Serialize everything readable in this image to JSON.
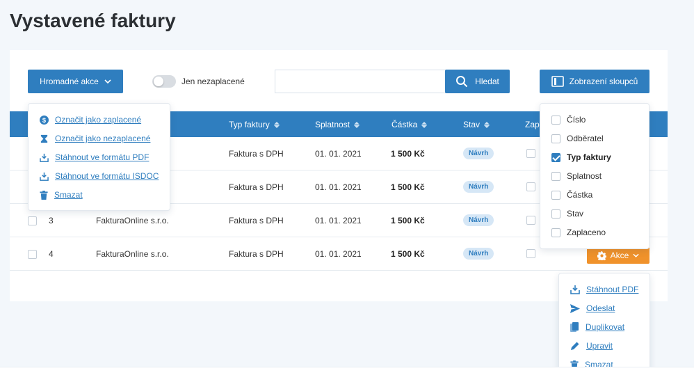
{
  "page": {
    "title": "Vystavené faktury"
  },
  "toolbar": {
    "bulk_label": "Hromadné akce",
    "toggle_label": "Jen nezaplacené",
    "search_placeholder": "",
    "search_label": "Hledat",
    "columns_label": "Zobrazení sloupců"
  },
  "table": {
    "headers": {
      "type": "Typ faktury",
      "due": "Splatnost",
      "amount": "Částka",
      "status": "Stav",
      "paid": "Zap"
    },
    "rows": [
      {
        "type": "Faktura s DPH",
        "due": "01. 01. 2021",
        "amount": "1 500 Kč",
        "status": "Návrh"
      },
      {
        "type": "Faktura s DPH",
        "due": "01. 01. 2021",
        "amount": "1 500 Kč",
        "status": "Návrh"
      },
      {
        "num": "3",
        "customer": "FakturaOnline s.r.o.",
        "type": "Faktura s DPH",
        "due": "01. 01. 2021",
        "amount": "1 500 Kč",
        "status": "Návrh"
      },
      {
        "num": "4",
        "customer": "FakturaOnline s.r.o.",
        "type": "Faktura s DPH",
        "due": "01. 01. 2021",
        "amount": "1 500 Kč",
        "status": "Návrh"
      }
    ],
    "row_action_label": "Akce"
  },
  "bulk_menu": {
    "items": [
      {
        "label": "Označit jako zaplacené",
        "icon": "dollar-coin-icon"
      },
      {
        "label": "Označit jako nezaplacené",
        "icon": "hourglass-icon"
      },
      {
        "label": "Stáhnout ve formátu PDF",
        "icon": "download-icon"
      },
      {
        "label": "Stáhnout ve formátu ISDOC",
        "icon": "download-icon"
      },
      {
        "label": "Smazat",
        "icon": "trash-icon"
      }
    ]
  },
  "columns_menu": {
    "items": [
      {
        "label": "Číslo",
        "checked": false
      },
      {
        "label": "Odběratel",
        "checked": false
      },
      {
        "label": "Typ faktury",
        "checked": true
      },
      {
        "label": "Splatnost",
        "checked": false
      },
      {
        "label": "Částka",
        "checked": false
      },
      {
        "label": "Stav",
        "checked": false
      },
      {
        "label": "Zaplaceno",
        "checked": false
      }
    ]
  },
  "row_menu": {
    "items": [
      {
        "label": "Stáhnout PDF",
        "icon": "download-icon"
      },
      {
        "label": "Odeslat",
        "icon": "send-icon"
      },
      {
        "label": "Duplikovat",
        "icon": "copy-icon"
      },
      {
        "label": "Upravit",
        "icon": "pencil-icon"
      },
      {
        "label": "Smazat",
        "icon": "trash-icon"
      }
    ]
  },
  "colors": {
    "primary": "#2f7ebf",
    "accent": "#f0922b",
    "badge_bg": "#d6e7f6"
  }
}
